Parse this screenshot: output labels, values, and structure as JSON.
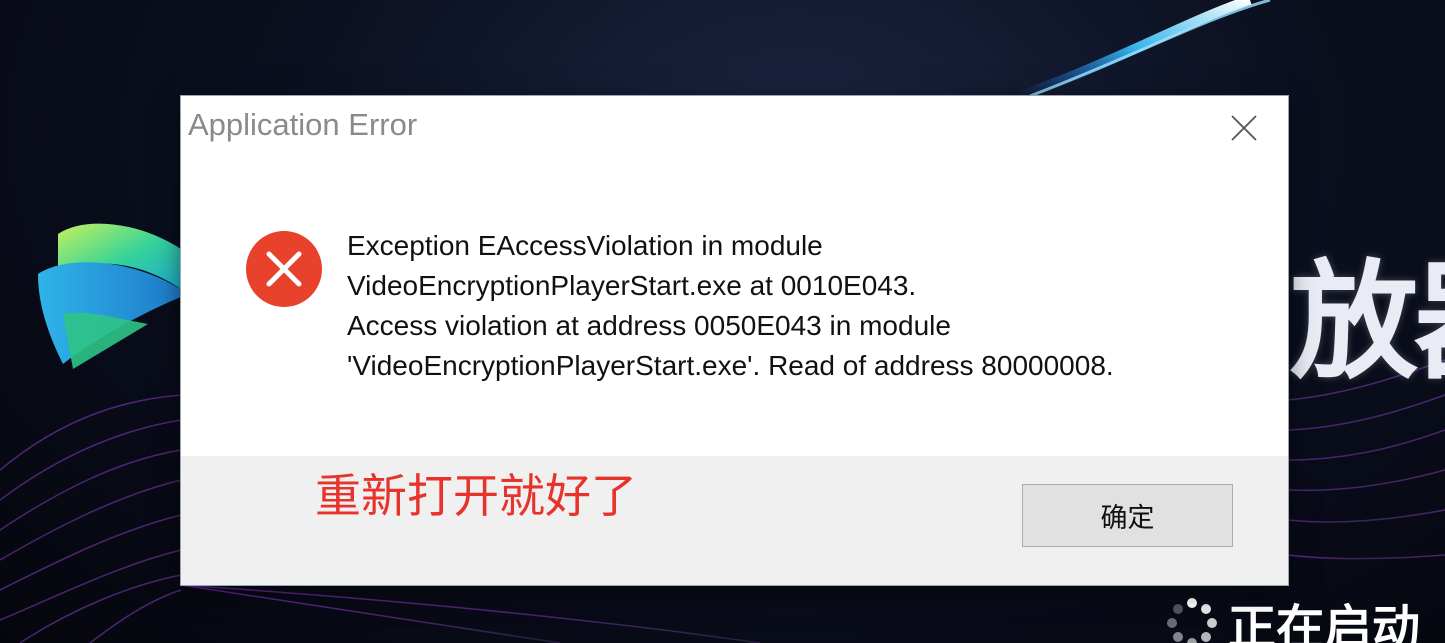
{
  "dialog": {
    "title": "Application Error",
    "message_lines": [
      "Exception EAccessViolation in module",
      "VideoEncryptionPlayerStart.exe at 0010E043.",
      "Access violation at address 0050E043 in module",
      "'VideoEncryptionPlayerStart.exe'. Read of address 80000008."
    ],
    "ok_label": "确定",
    "error_color": "#e8412c"
  },
  "annotation": {
    "text": "重新打开就好了",
    "color": "#e8332c"
  },
  "splash": {
    "title_partial": "放器",
    "status_partial": "正在启动"
  }
}
